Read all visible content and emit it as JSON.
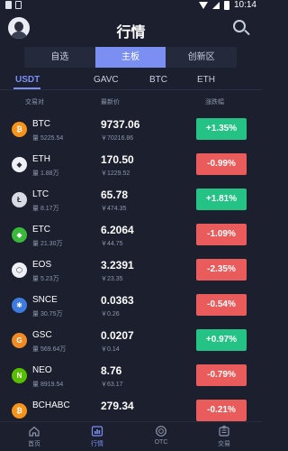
{
  "status_bar": {
    "time": "10:14"
  },
  "header": {
    "title": "行情"
  },
  "segment_tabs": [
    {
      "label": "自选",
      "active": false
    },
    {
      "label": "主板",
      "active": true
    },
    {
      "label": "创新区",
      "active": false
    }
  ],
  "base_tabs": [
    {
      "label": "USDT",
      "active": true
    },
    {
      "label": "GAVC",
      "active": false
    },
    {
      "label": "BTC",
      "active": false
    },
    {
      "label": "ETH",
      "active": false
    }
  ],
  "columns": {
    "pair": "交易对",
    "price": "最新价",
    "change": "涨跌幅"
  },
  "colors": {
    "up": "#25c285",
    "down": "#ea5c5c",
    "accent": "#7b8ff2",
    "background": "#1b1f2e"
  },
  "coins": [
    {
      "symbol": "BTC",
      "volume": "量 5225.54",
      "price": "9737.06",
      "cny": "￥70216.86",
      "change": "+1.35%",
      "direction": "up",
      "icon": "btc-icon",
      "icon_color": "#f7931a",
      "glyph": "₿"
    },
    {
      "symbol": "ETH",
      "volume": "量 1.88万",
      "price": "170.50",
      "cny": "￥1229.52",
      "change": "-0.99%",
      "direction": "down",
      "icon": "eth-icon",
      "icon_color": "#eef0f5",
      "glyph": "◆"
    },
    {
      "symbol": "LTC",
      "volume": "量 8.17万",
      "price": "65.78",
      "cny": "￥474.35",
      "change": "+1.81%",
      "direction": "up",
      "icon": "ltc-icon",
      "icon_color": "#d8dbe3",
      "glyph": "Ł"
    },
    {
      "symbol": "ETC",
      "volume": "量 21.30万",
      "price": "6.2064",
      "cny": "￥44.75",
      "change": "-1.09%",
      "direction": "down",
      "icon": "etc-icon",
      "icon_color": "#3ab83a",
      "glyph": "◆"
    },
    {
      "symbol": "EOS",
      "volume": "量 5.23万",
      "price": "3.2391",
      "cny": "￥23.35",
      "change": "-2.35%",
      "direction": "down",
      "icon": "eos-icon",
      "icon_color": "#eef0f5",
      "glyph": "⬡"
    },
    {
      "symbol": "SNCE",
      "volume": "量 30.75万",
      "price": "0.0363",
      "cny": "￥0.26",
      "change": "-0.54%",
      "direction": "down",
      "icon": "snce-icon",
      "icon_color": "#3e7be0",
      "glyph": "✱"
    },
    {
      "symbol": "GSC",
      "volume": "量 569.64万",
      "price": "0.0207",
      "cny": "￥0.14",
      "change": "+0.97%",
      "direction": "up",
      "icon": "gsc-icon",
      "icon_color": "#f08a24",
      "glyph": "G"
    },
    {
      "symbol": "NEO",
      "volume": "量 8919.54",
      "price": "8.76",
      "cny": "￥63.17",
      "change": "-0.79%",
      "direction": "down",
      "icon": "neo-icon",
      "icon_color": "#58bf00",
      "glyph": "N"
    },
    {
      "symbol": "BCHABC",
      "volume": "",
      "price": "279.34",
      "cny": "",
      "change": "-0.21%",
      "direction": "down",
      "icon": "bch-icon",
      "icon_color": "#f7931a",
      "glyph": "₿"
    }
  ],
  "bottom_nav": [
    {
      "label": "首页",
      "active": false,
      "icon": "home-icon"
    },
    {
      "label": "行情",
      "active": true,
      "icon": "market-icon"
    },
    {
      "label": "OTC",
      "active": false,
      "icon": "otc-icon"
    },
    {
      "label": "交易",
      "active": false,
      "icon": "trade-icon"
    }
  ]
}
